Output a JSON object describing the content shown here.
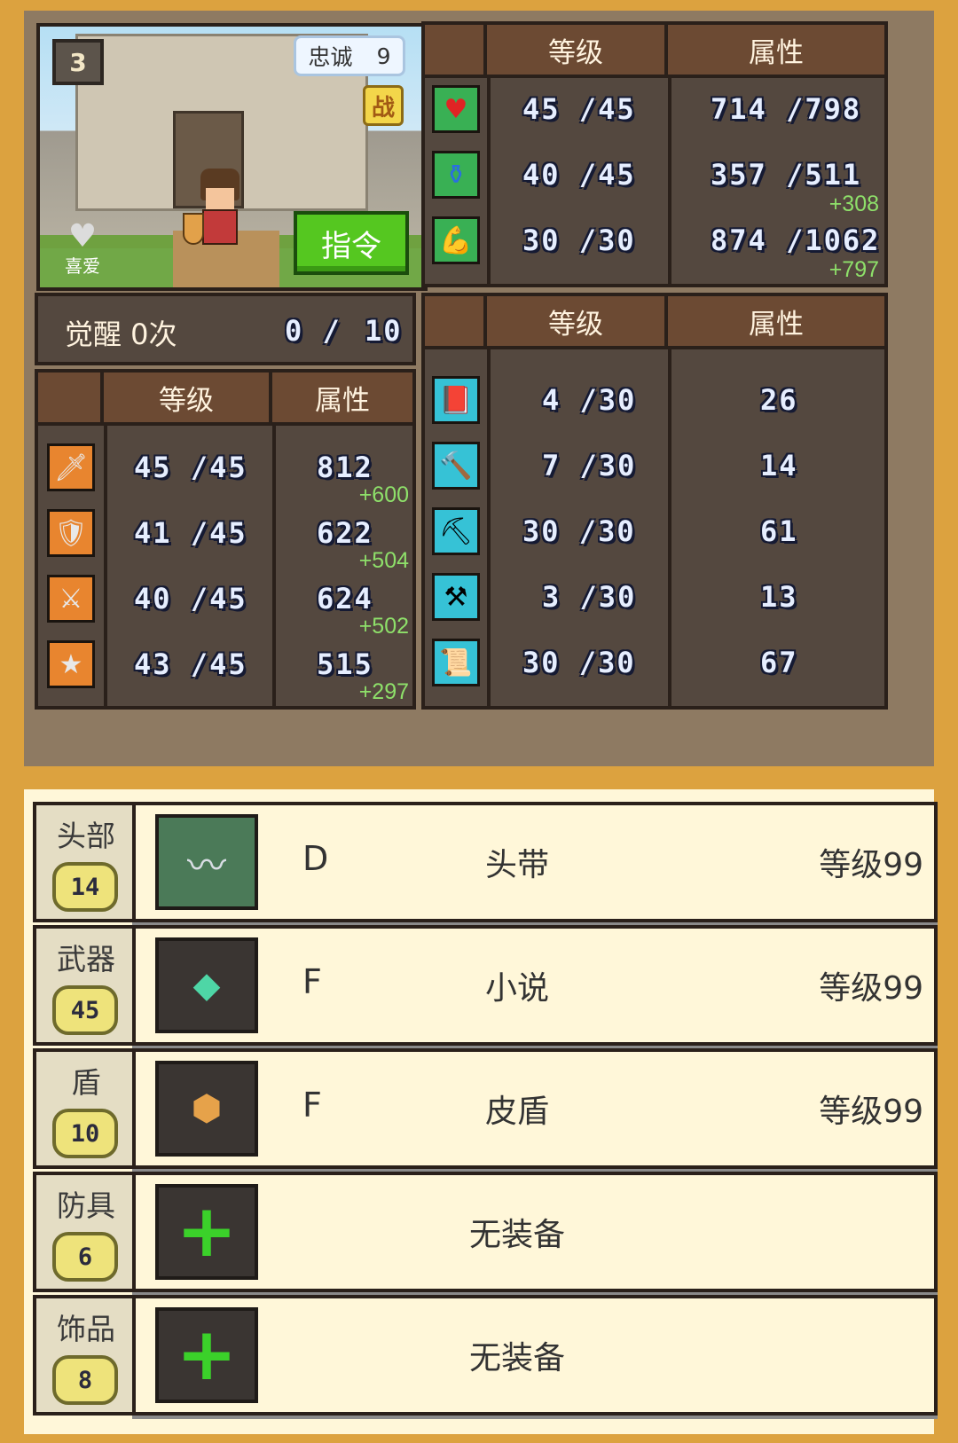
{
  "portrait": {
    "loyalty_label": "忠诚",
    "loyalty_value": "9",
    "battle_badge": "战",
    "favorite_label": "喜爱",
    "command_button": "指令"
  },
  "top_table": {
    "header_level": "等级",
    "header_attr": "属性",
    "rows": [
      {
        "icon": "heart-icon",
        "level": "45 /45",
        "attr": "714 /798",
        "bonus": ""
      },
      {
        "icon": "potion-icon",
        "level": "40 /45",
        "attr": "357 /511",
        "bonus": "+308"
      },
      {
        "icon": "muscle-icon",
        "level": "30 /30",
        "attr": "874 /1062",
        "bonus": "+797"
      }
    ]
  },
  "awaken": {
    "label": "觉醒 0次",
    "progress": "0 /",
    "max": "10"
  },
  "combat_table": {
    "header_level": "等级",
    "header_attr": "属性",
    "rows": [
      {
        "icon": "sword-icon",
        "level": "45 /45",
        "attr": "812",
        "bonus": "+600"
      },
      {
        "icon": "shield-icon",
        "level": "41 /45",
        "attr": "622",
        "bonus": "+504"
      },
      {
        "icon": "armor-icon",
        "level": "40 /45",
        "attr": "624",
        "bonus": "+502"
      },
      {
        "icon": "star-icon",
        "level": "43 /45",
        "attr": "515",
        "bonus": "+297"
      }
    ]
  },
  "skill_table": {
    "header_level": "等级",
    "header_attr": "属性",
    "rows": [
      {
        "icon": "book-icon",
        "level": "4 /30",
        "attr": "26"
      },
      {
        "icon": "hammer-icon",
        "level": "7 /30",
        "attr": "14"
      },
      {
        "icon": "shovel-icon",
        "level": "30 /30",
        "attr": "61"
      },
      {
        "icon": "anvil-icon",
        "level": "3 /30",
        "attr": "13"
      },
      {
        "icon": "scroll-icon",
        "level": "30 /30",
        "attr": "67"
      }
    ]
  },
  "equipment": [
    {
      "slot": "头部",
      "badge": "14",
      "grade": "D",
      "name": "头带",
      "level": "等级99",
      "empty": false
    },
    {
      "slot": "武器",
      "badge": "45",
      "grade": "F",
      "name": "小说",
      "level": "等级99",
      "empty": false
    },
    {
      "slot": "盾",
      "badge": "10",
      "grade": "F",
      "name": "皮盾",
      "level": "等级99",
      "empty": false
    },
    {
      "slot": "防具",
      "badge": "6",
      "grade": "",
      "name": "无装备",
      "level": "",
      "empty": true
    },
    {
      "slot": "饰品",
      "badge": "8",
      "grade": "",
      "name": "无装备",
      "level": "",
      "empty": true
    }
  ],
  "colors": {
    "background": "#dca23f",
    "panel": "#54483f",
    "header": "#6c4a33",
    "bonus_text": "#8ee06a",
    "equip_bg": "#fff7d9"
  }
}
